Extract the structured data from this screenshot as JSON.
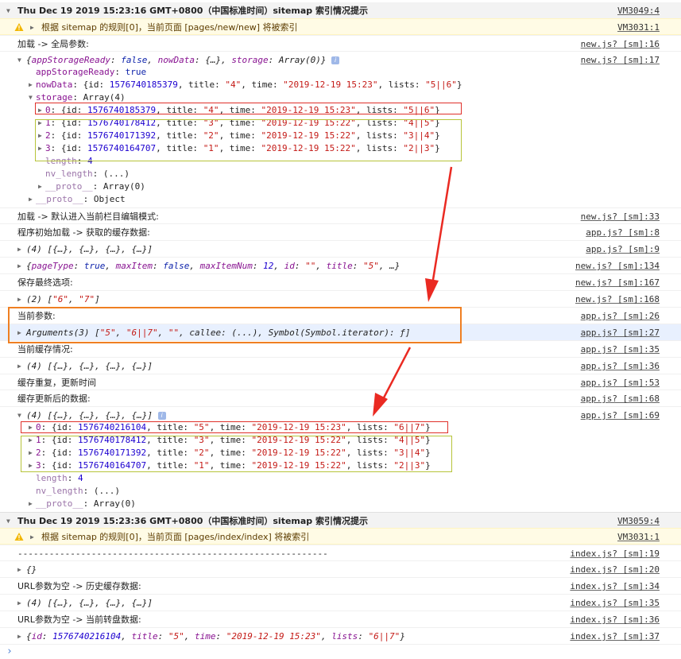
{
  "groups": [
    {
      "header": "Thu Dec 19 2019 15:23:16 GMT+0800（中国标准时间）sitemap 索引情况提示",
      "header_src": "VM3049:4",
      "warning": "根据 sitemap 的规则[0]，当前页面 [pages/new/new] 将被索引",
      "warning_src": "VM3031:1"
    },
    {
      "header": "Thu Dec 19 2019 15:23:36 GMT+0800（中国标准时间）sitemap 索引情况提示",
      "header_src": "VM3059:4",
      "warning": "根据 sitemap 的规则[0]，当前页面 [pages/index/index] 将被索引",
      "warning_src": "VM3031:1"
    }
  ],
  "log": {
    "l1": {
      "text": "加载 -> 全局参数:",
      "src": "new.js? [sm]:16"
    },
    "l2": {
      "src": "new.js? [sm]:17"
    },
    "l3": {
      "text": "加载 -> 默认进入当前栏目编辑模式:",
      "src": "new.js? [sm]:33"
    },
    "l4": {
      "text": "程序初始加载 -> 获取的缓存数据:",
      "src": "app.js? [sm]:8"
    },
    "l5": {
      "text": "(4) [{…}, {…}, {…}, {…}]",
      "src": "app.js? [sm]:9"
    },
    "l6": {
      "src": "new.js? [sm]:134"
    },
    "l7": {
      "text": "保存最终选项:",
      "src": "new.js? [sm]:167"
    },
    "l8": {
      "src": "new.js? [sm]:168"
    },
    "l9": {
      "text": "当前参数:",
      "src": "app.js? [sm]:26"
    },
    "l10": {
      "src": "app.js? [sm]:27"
    },
    "l11": {
      "text": "当前缓存情况:",
      "src": "app.js? [sm]:35"
    },
    "l12": {
      "text": "(4) [{…}, {…}, {…}, {…}]",
      "src": "app.js? [sm]:36"
    },
    "l13": {
      "text": "缓存重复，更新时间",
      "src": "app.js? [sm]:53"
    },
    "l14": {
      "text": "缓存更新后的数据:",
      "src": "app.js? [sm]:68"
    },
    "l15": {
      "src": "app.js? [sm]:69"
    },
    "m1": {
      "text": "-----------------------------------------------------------",
      "src": "index.js? [sm]:19"
    },
    "m2": {
      "text": "{}",
      "src": "index.js? [sm]:20"
    },
    "m3": {
      "text": "URL参数为空 -> 历史缓存数据:",
      "src": "index.js? [sm]:34"
    },
    "m4": {
      "text": "(4) [{…}, {…}, {…}, {…}]",
      "src": "index.js? [sm]:35"
    },
    "m5": {
      "text": "URL参数为空 -> 当前转盘数据:",
      "src": "index.js? [sm]:36"
    },
    "m6": {
      "src": "index.js? [sm]:37"
    }
  },
  "vals": {
    "false": "false",
    "true": "true",
    "empty": "\"\"",
    "v1576740185379": "1576740185379",
    "v1576740178412": "1576740178412",
    "v1576740171392": "1576740171392",
    "v1576740164707": "1576740164707",
    "v1576740216104": "1576740216104",
    "v12": "12",
    "s4": "\"4\"",
    "s3": "\"3\"",
    "s2": "\"2\"",
    "s1": "\"1\"",
    "s5": "\"5\"",
    "s6": "\"6\"",
    "s7": "\"7\"",
    "t1523": "\"2019-12-19 15:23\"",
    "t1522": "\"2019-12-19 15:22\"",
    "l56": "\"5||6\"",
    "l45": "\"4||5\"",
    "l34": "\"3||4\"",
    "l23": "\"2||3\"",
    "l67": "\"6||7\"",
    "q67": "\"6||7\""
  },
  "colors": {
    "highlight_red": "#e0302a",
    "highlight_yellow": "#b7c43a",
    "highlight_orange": "#ef7f22"
  },
  "icons": {
    "expand": "triangle-right",
    "collapse": "triangle-down",
    "warning": "warning-triangle",
    "info": "info-badge",
    "prompt": "chevron-right"
  }
}
